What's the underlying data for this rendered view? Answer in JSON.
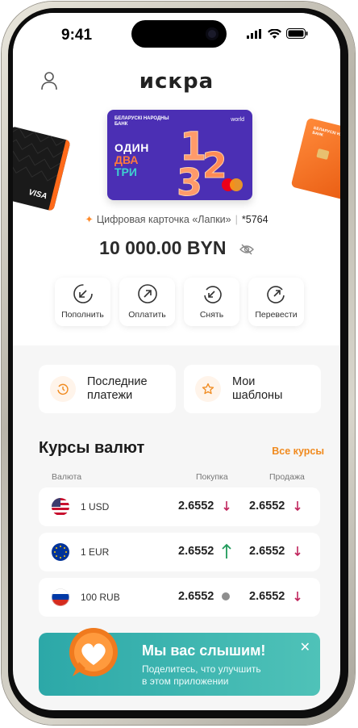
{
  "status_bar": {
    "time": "9:41"
  },
  "header": {
    "logo": "искра"
  },
  "card": {
    "bank_name": "БЕЛАРУСКІ НАРОДНЫ БАНК",
    "network": "world",
    "art_words": [
      "ОДИН",
      "ДВА",
      "ТРИ"
    ],
    "name": "Цифровая карточка «Лапки»",
    "number": "*5764",
    "balance": "10 000.00 BYN"
  },
  "side_cards": {
    "left_brand": "VISA",
    "right_bank": "БЕЛАРУСКІ НАРОДНЫ БАНК"
  },
  "actions": [
    {
      "label": "Пополнить",
      "icon": "arrow-down-left-icon"
    },
    {
      "label": "Оплатить",
      "icon": "arrow-up-right-icon"
    },
    {
      "label": "Снять",
      "icon": "rotate-left-icon"
    },
    {
      "label": "Перевести",
      "icon": "rotate-right-icon"
    }
  ],
  "quick_links": [
    {
      "label": "Последние платежи",
      "line1": "Последние",
      "line2": "платежи",
      "icon": "history-icon"
    },
    {
      "label": "Мои шаблоны",
      "line1": "Мои",
      "line2": "шаблоны",
      "icon": "star-icon"
    }
  ],
  "rates": {
    "title": "Курсы валют",
    "all_link": "Все курсы",
    "columns": {
      "currency": "Валюта",
      "buy": "Покупка",
      "sell": "Продажа"
    },
    "rows": [
      {
        "currency": "1 USD",
        "buy": "2.6552",
        "buy_trend": "down",
        "sell": "2.6552",
        "sell_trend": "down",
        "flag": "usa-flag-icon"
      },
      {
        "currency": "1 EUR",
        "buy": "2.6552",
        "buy_trend": "up",
        "sell": "2.6552",
        "sell_trend": "down",
        "flag": "eu-flag-icon"
      },
      {
        "currency": "100 RUB",
        "buy": "2.6552",
        "buy_trend": "none",
        "sell": "2.6552",
        "sell_trend": "down",
        "flag": "russia-flag-icon"
      }
    ]
  },
  "banner": {
    "title": "Мы вас слышим!",
    "subtitle_line1": "Поделитесь, что улучшить",
    "subtitle_line2": "в этом приложении",
    "close": "✕"
  },
  "colors": {
    "accent": "#f08a1e",
    "down": "#c0245c",
    "up": "#1f9a5a",
    "banner": "#2ca8a8",
    "card": "#4b2fb4"
  }
}
